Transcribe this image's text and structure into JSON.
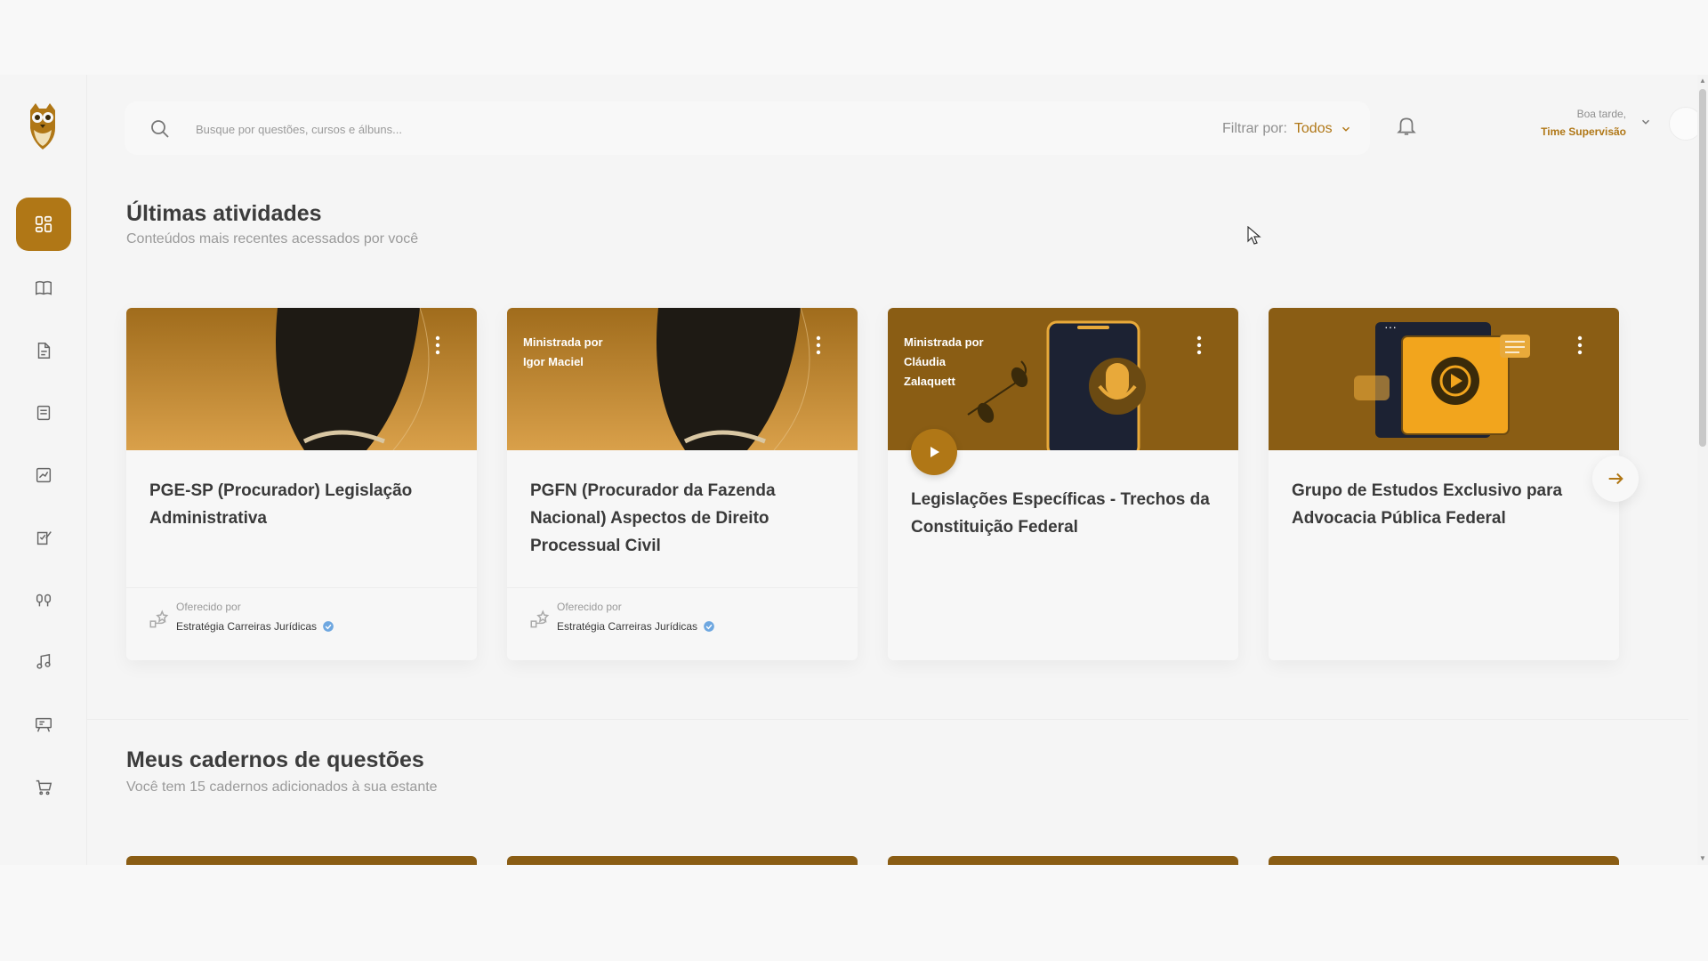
{
  "header": {
    "search_placeholder": "Busque por questões, cursos e álbuns...",
    "filter_label": "Filtrar por:",
    "filter_value": "Todos",
    "greeting_line1": "Boa tarde,",
    "greeting_line2": "Time Supervisão"
  },
  "sidebar": {
    "items": [
      {
        "icon": "dashboard-icon",
        "active": true
      },
      {
        "icon": "book-icon"
      },
      {
        "icon": "document-icon"
      },
      {
        "icon": "notebook-icon"
      },
      {
        "icon": "chart-icon"
      },
      {
        "icon": "edit-note-icon"
      },
      {
        "icon": "headphones-icon"
      },
      {
        "icon": "music-note-icon"
      },
      {
        "icon": "whiteboard-icon"
      },
      {
        "icon": "cart-icon"
      }
    ]
  },
  "recent": {
    "title": "Últimas atividades",
    "subtitle": "Conteúdos mais recentes acessados por você",
    "cards": [
      {
        "title": "PGE-SP (Procurador) Legislação Administrativa",
        "offered_label": "Oferecido por",
        "offered_by": "Estratégia Carreiras Jurídicas"
      },
      {
        "banner_line1": "Ministrada por",
        "banner_line2": "Igor Maciel",
        "title": "PGFN (Procurador da Fazenda Nacional) Aspectos de Direito Processual Civil",
        "offered_label": "Oferecido por",
        "offered_by": "Estratégia Carreiras Jurídicas"
      },
      {
        "banner_line1": "Ministrada por",
        "banner_line2": "Cláudia",
        "banner_line3": "Zalaquett",
        "title": "Legislações Específicas - Trechos da Constituição Federal"
      },
      {
        "title": "Grupo de Estudos Exclusivo para Advocacia Pública Federal"
      }
    ]
  },
  "notebooks": {
    "title": "Meus cadernos de questões",
    "subtitle": "Você tem 15 cadernos adicionados à sua estante"
  },
  "colors": {
    "accent": "#b07716",
    "banner": "#8a5d14",
    "background": "#f5f5f5"
  }
}
